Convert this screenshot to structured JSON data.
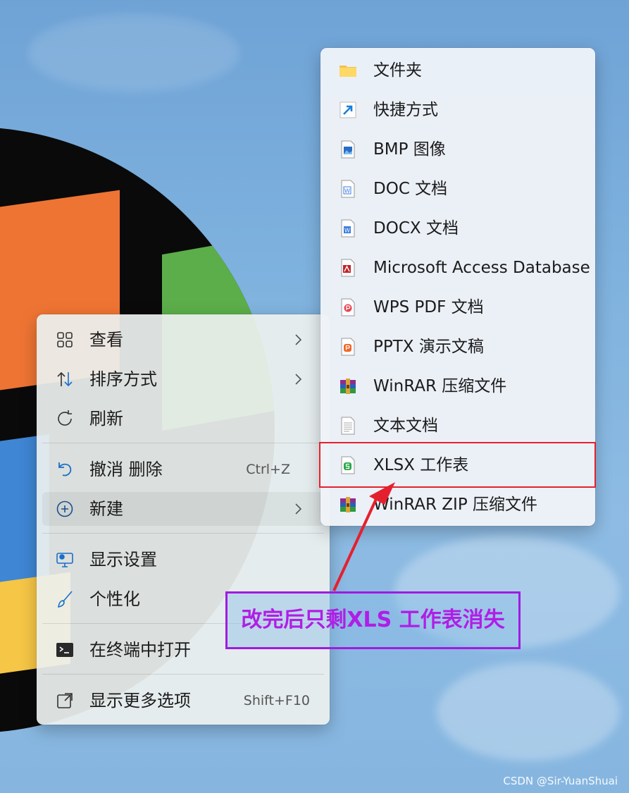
{
  "context_menu": {
    "items": [
      {
        "label": "查看",
        "icon": "grid-view-icon",
        "has_submenu": true
      },
      {
        "label": "排序方式",
        "icon": "sort-icon",
        "has_submenu": true
      },
      {
        "label": "刷新",
        "icon": "refresh-icon",
        "has_submenu": false
      },
      {
        "label": "撤消 删除",
        "icon": "undo-icon",
        "shortcut": "Ctrl+Z"
      },
      {
        "label": "新建",
        "icon": "new-plus-icon",
        "has_submenu": true,
        "active": true
      },
      {
        "label": "显示设置",
        "icon": "display-settings-icon"
      },
      {
        "label": "个性化",
        "icon": "brush-icon"
      },
      {
        "label": "在终端中打开",
        "icon": "terminal-icon"
      },
      {
        "label": "显示更多选项",
        "icon": "more-options-icon",
        "shortcut": "Shift+F10"
      }
    ]
  },
  "new_submenu": {
    "items": [
      {
        "label": "文件夹",
        "icon": "folder-icon"
      },
      {
        "label": "快捷方式",
        "icon": "shortcut-icon"
      },
      {
        "label": "BMP 图像",
        "icon": "bmp-image-icon"
      },
      {
        "label": "DOC 文档",
        "icon": "doc-icon"
      },
      {
        "label": "DOCX 文档",
        "icon": "docx-icon"
      },
      {
        "label": "Microsoft Access Database",
        "icon": "access-icon"
      },
      {
        "label": "WPS PDF 文档",
        "icon": "pdf-icon"
      },
      {
        "label": "PPTX 演示文稿",
        "icon": "pptx-icon"
      },
      {
        "label": "WinRAR 压缩文件",
        "icon": "winrar-icon"
      },
      {
        "label": "文本文档",
        "icon": "text-document-icon"
      },
      {
        "label": "XLSX 工作表",
        "icon": "xlsx-icon",
        "highlighted": true
      },
      {
        "label": "WinRAR ZIP 压缩文件",
        "icon": "winrar-zip-icon"
      }
    ]
  },
  "annotation": {
    "text": "改完后只剩XLS 工作表消失",
    "color": "#b01ee6",
    "highlight_color": "#e5202e"
  },
  "watermark": "CSDN @Sir-YuanShuai"
}
